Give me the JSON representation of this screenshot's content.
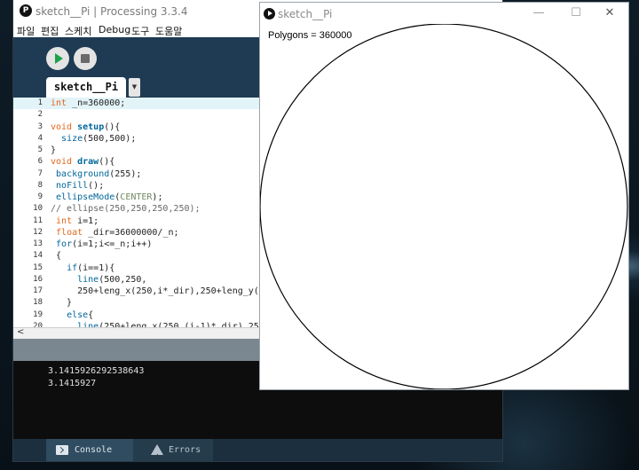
{
  "ide": {
    "app_icon": "processing-logo",
    "title": "sketch__Pi | Processing 3.3.4",
    "menu": [
      "파일",
      "편집",
      "스케치",
      "Debug",
      "도구",
      "도움말"
    ],
    "toolbar": {
      "run_icon": "play-icon",
      "stop_icon": "stop-icon"
    },
    "tab": {
      "label": "sketch__Pi",
      "dropdown_icon": "chevron-down-icon"
    },
    "editor": {
      "current_line": 1,
      "lines": [
        {
          "n": "1",
          "code": "int _n=360000;"
        },
        {
          "n": "2",
          "code": ""
        },
        {
          "n": "3",
          "code": "void setup(){"
        },
        {
          "n": "4",
          "code": "  size(500,500);"
        },
        {
          "n": "5",
          "code": "}"
        },
        {
          "n": "6",
          "code": "void draw(){"
        },
        {
          "n": "7",
          "code": " background(255);"
        },
        {
          "n": "8",
          "code": " noFill();"
        },
        {
          "n": "9",
          "code": " ellipseMode(CENTER);"
        },
        {
          "n": "10",
          "code": "// ellipse(250,250,250,250);"
        },
        {
          "n": "11",
          "code": " int i=1;"
        },
        {
          "n": "12",
          "code": " float _dir=36000000/_n;"
        },
        {
          "n": "13",
          "code": " for(i=1;i<=_n;i++)"
        },
        {
          "n": "14",
          "code": " {"
        },
        {
          "n": "15",
          "code": "   if(i==1){"
        },
        {
          "n": "16",
          "code": "     line(500,250,"
        },
        {
          "n": "17",
          "code": "     250+leng_x(250,i*_dir),250+leng_y(25"
        },
        {
          "n": "18",
          "code": "   }"
        },
        {
          "n": "19",
          "code": "   else{"
        },
        {
          "n": "20",
          "code": "     line(250+leng_x(250,(i-1)*_dir),250+"
        }
      ]
    },
    "hscroll_arrow": "<",
    "console": {
      "lines": [
        "3.1415926292538643",
        "3.1415927"
      ]
    },
    "footer": {
      "console_label": "Console",
      "errors_label": "Errors"
    }
  },
  "sketch": {
    "title": "sketch__Pi",
    "controls": {
      "minimize": "—",
      "maximize": "☐",
      "close": "✕"
    },
    "canvas_text": "Polygons = 360000",
    "circle": {
      "stroke": "#000000",
      "fill": "none"
    }
  }
}
